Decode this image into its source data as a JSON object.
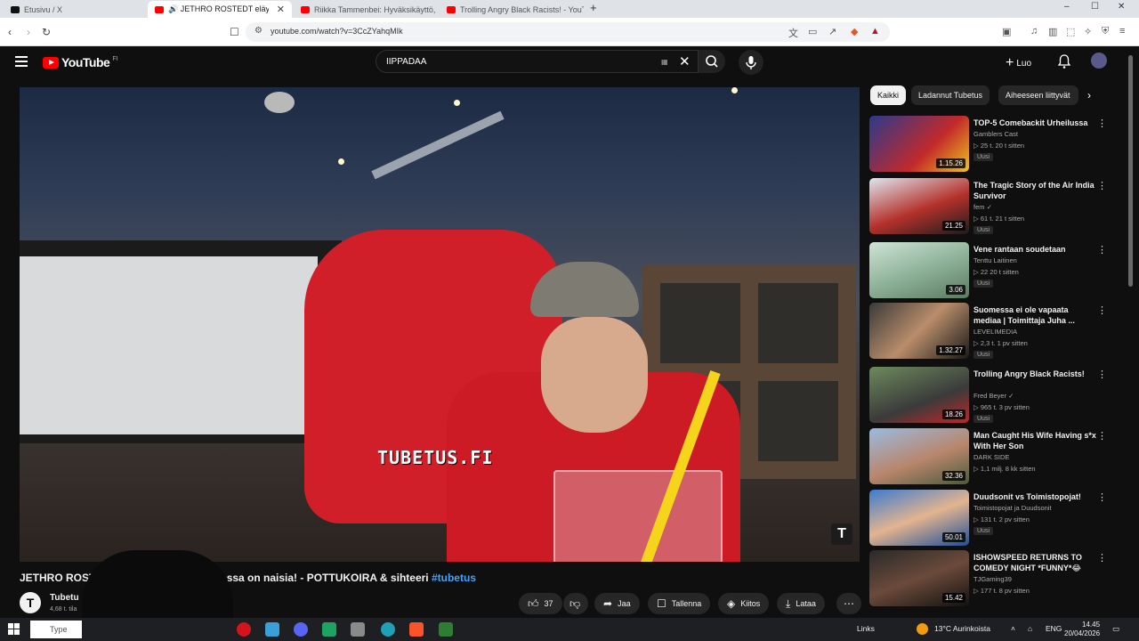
{
  "browser": {
    "tabs": [
      {
        "label": "Etusivu / X",
        "color": "#111111",
        "active": false
      },
      {
        "label": "🔊 JETHRO ROSTEDT eläyy naisten",
        "color": "#ff0000",
        "active": true
      },
      {
        "label": "Riikka Tammenbei: Hyväksikäyttö, Pä",
        "color": "#ff0000",
        "active": false
      },
      {
        "label": "Trolling Angry Black Racists! - YouTub",
        "color": "#ff0000",
        "active": false
      }
    ],
    "new_tab": "+",
    "url": "youtube.com/watch?v=3CcZYahqMIk",
    "window_controls": [
      "–",
      "☐",
      "✕"
    ]
  },
  "header": {
    "logo_text": "YouTube",
    "country": "FI",
    "search_value": "IIPPADAA",
    "create_label": "Luo"
  },
  "video": {
    "watermark": "TUBETUS.FI",
    "badge": "T",
    "title_start": "JETHRO ROSTE",
    "title_end": "n jossa on naisia! - POTTUKOIRA & sihteeri",
    "hashtag": "#tubetus"
  },
  "channel": {
    "initial": "T",
    "name": "Tubetu",
    "subs": "4,68 t. tila"
  },
  "actions": {
    "likes": "37",
    "share": "Jaa",
    "save": "Tallenna",
    "thanks": "Kiitos",
    "download": "Lataa",
    "more": "⋯"
  },
  "chips": [
    "Kaikki",
    "Ladannut Tubetus",
    "Aiheeseen liittyvät"
  ],
  "recommendations": [
    {
      "title": "TOP-5 Comebackit Urheilussa",
      "channel": "Gamblers Cast",
      "meta": "▷ 25 t.   20 t sitten",
      "new": "Uusi",
      "duration": "1.15.26",
      "thumb": "linear-gradient(135deg,#2b3a8c,#c22a2a 60%,#f0c419)"
    },
    {
      "title": "The Tragic Story of the Air India Survivor",
      "channel": "fem ✓",
      "meta": "▷ 61 t.   21 t sitten",
      "new": "Uusi",
      "duration": "21.25",
      "thumb": "linear-gradient(160deg,#dfe6ee,#b4312b 55%,#1c1c1c)"
    },
    {
      "title": "Vene rantaan soudetaan",
      "channel": "Tenttu Laitinen",
      "meta": "▷ 22   20 t sitten",
      "new": "Uusi",
      "duration": "3.06",
      "thumb": "linear-gradient(160deg,#cfe3d6,#8fb39a 50%,#5c7a60)"
    },
    {
      "title": "Suomessa ei ole vapaata mediaa | Toimittaja Juha ...",
      "channel": "LEVELIMEDIA",
      "meta": "▷ 2,3 t.   1 pv sitten",
      "new": "Uusi",
      "duration": "1.32.27",
      "thumb": "linear-gradient(135deg,#3a3a3a,#b98d6a 50%,#1a1a1a)"
    },
    {
      "title": "Trolling Angry Black Racists!",
      "channel": "Fred Beyer ✓",
      "meta": "▷ 965 t.   3 pv sitten",
      "new": "Uusi",
      "duration": "18.26",
      "thumb": "linear-gradient(160deg,#6d8a5c,#3b3b3b 60%,#c02626)"
    },
    {
      "title": "Man Caught His Wife Having s*x With Her Son",
      "channel": "DARK SIDE",
      "meta": "▷ 1,1 milj.   8 kk sitten",
      "new": "",
      "duration": "32.36",
      "thumb": "linear-gradient(160deg,#9bbbe0,#b8866b 55%,#4b5a3c)"
    },
    {
      "title": "Duudsonit vs Toimistopojat!",
      "channel": "Toimistopojat ja Duudsonit",
      "meta": "▷ 131 t.   2 pv sitten",
      "new": "Uusi",
      "duration": "50.01",
      "thumb": "linear-gradient(160deg,#3c7bd0,#e3b48f 50%,#1f4f99)"
    },
    {
      "title": "ISHOWSPEED RETURNS TO COMEDY NIGHT *FUNNY*😂",
      "channel": "TJGaming39",
      "meta": "▷ 177 t.   8 pv sitten",
      "new": "",
      "duration": "15.42",
      "thumb": "linear-gradient(160deg,#2a2a2a,#6b4a3a 50%,#121212)"
    }
  ],
  "taskbar": {
    "search_placeholder": "Type",
    "links": "Links",
    "weather": "13°C  Aurinkoista",
    "lang": "ENG",
    "time": "14.45",
    "date": "20/04/2026"
  }
}
